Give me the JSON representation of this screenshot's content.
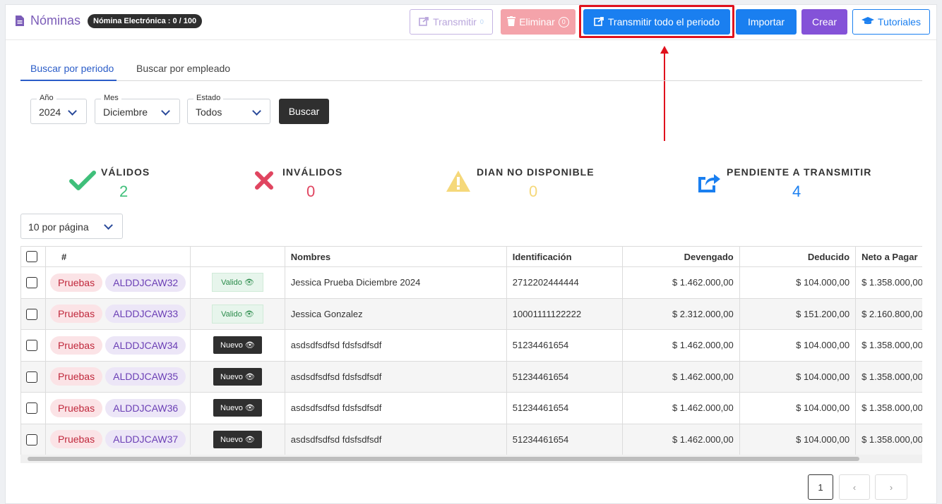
{
  "header": {
    "title": "Nóminas",
    "badge": "Nómina Electrónica : 0 / 100",
    "buttons": {
      "transmitir": "Transmitir",
      "transmitir_count": "0",
      "eliminar": "Eliminar",
      "eliminar_count": "0",
      "transmitir_todo": "Transmitir todo el periodo",
      "importar": "Importar",
      "crear": "Crear",
      "tutoriales": "Tutoriales"
    }
  },
  "tabs": [
    {
      "label": "Buscar por periodo",
      "active": true
    },
    {
      "label": "Buscar por empleado",
      "active": false
    }
  ],
  "filters": {
    "year": {
      "label": "Año",
      "value": "2024"
    },
    "month": {
      "label": "Mes",
      "value": "Diciembre"
    },
    "state": {
      "label": "Estado",
      "value": "Todos"
    },
    "search_button": "Buscar"
  },
  "stats": {
    "validos": {
      "label": "VÁLIDOS",
      "value": "2",
      "color": "#3fbf7a"
    },
    "invalidos": {
      "label": "INVÁLIDOS",
      "value": "0",
      "color": "#e04560"
    },
    "dian": {
      "label": "DIAN NO DISPONIBLE",
      "value": "0",
      "color": "#f5d87a"
    },
    "pendiente": {
      "label": "PENDIENTE A TRANSMITIR",
      "value": "4",
      "color": "#1a7ff0"
    }
  },
  "per_page": "10 por página",
  "table": {
    "columns": [
      "#",
      "",
      "Nombres",
      "Identificación",
      "Devengado",
      "Deducido",
      "Neto a Pagar"
    ],
    "rows": [
      {
        "env": "Pruebas",
        "code": "ALDDJCAW32",
        "state": "Valido",
        "name": "Jessica Prueba Diciembre 2024",
        "id": "2712202444444",
        "devengado": "$ 1.462.000,00",
        "deducido": "$ 104.000,00",
        "neto": "$ 1.358.000,00"
      },
      {
        "env": "Pruebas",
        "code": "ALDDJCAW33",
        "state": "Valido",
        "name": "Jessica Gonzalez",
        "id": "10001111122222",
        "devengado": "$ 2.312.000,00",
        "deducido": "$ 151.200,00",
        "neto": "$ 2.160.800,00"
      },
      {
        "env": "Pruebas",
        "code": "ALDDJCAW34",
        "state": "Nuevo",
        "name": "asdsdfsdfsd fdsfsdfsdf",
        "id": "51234461654",
        "devengado": "$ 1.462.000,00",
        "deducido": "$ 104.000,00",
        "neto": "$ 1.358.000,00"
      },
      {
        "env": "Pruebas",
        "code": "ALDDJCAW35",
        "state": "Nuevo",
        "name": "asdsdfsdfsd fdsfsdfsdf",
        "id": "51234461654",
        "devengado": "$ 1.462.000,00",
        "deducido": "$ 104.000,00",
        "neto": "$ 1.358.000,00"
      },
      {
        "env": "Pruebas",
        "code": "ALDDJCAW36",
        "state": "Nuevo",
        "name": "asdsdfsdfsd fdsfsdfsdf",
        "id": "51234461654",
        "devengado": "$ 1.462.000,00",
        "deducido": "$ 104.000,00",
        "neto": "$ 1.358.000,00"
      },
      {
        "env": "Pruebas",
        "code": "ALDDJCAW37",
        "state": "Nuevo",
        "name": "asdsdfsdfsd fdsfsdfsdf",
        "id": "51234461654",
        "devengado": "$ 1.462.000,00",
        "deducido": "$ 104.000,00",
        "neto": "$ 1.358.000,00"
      }
    ]
  },
  "pagination": {
    "current": "1",
    "prev": "‹",
    "next": "›"
  }
}
